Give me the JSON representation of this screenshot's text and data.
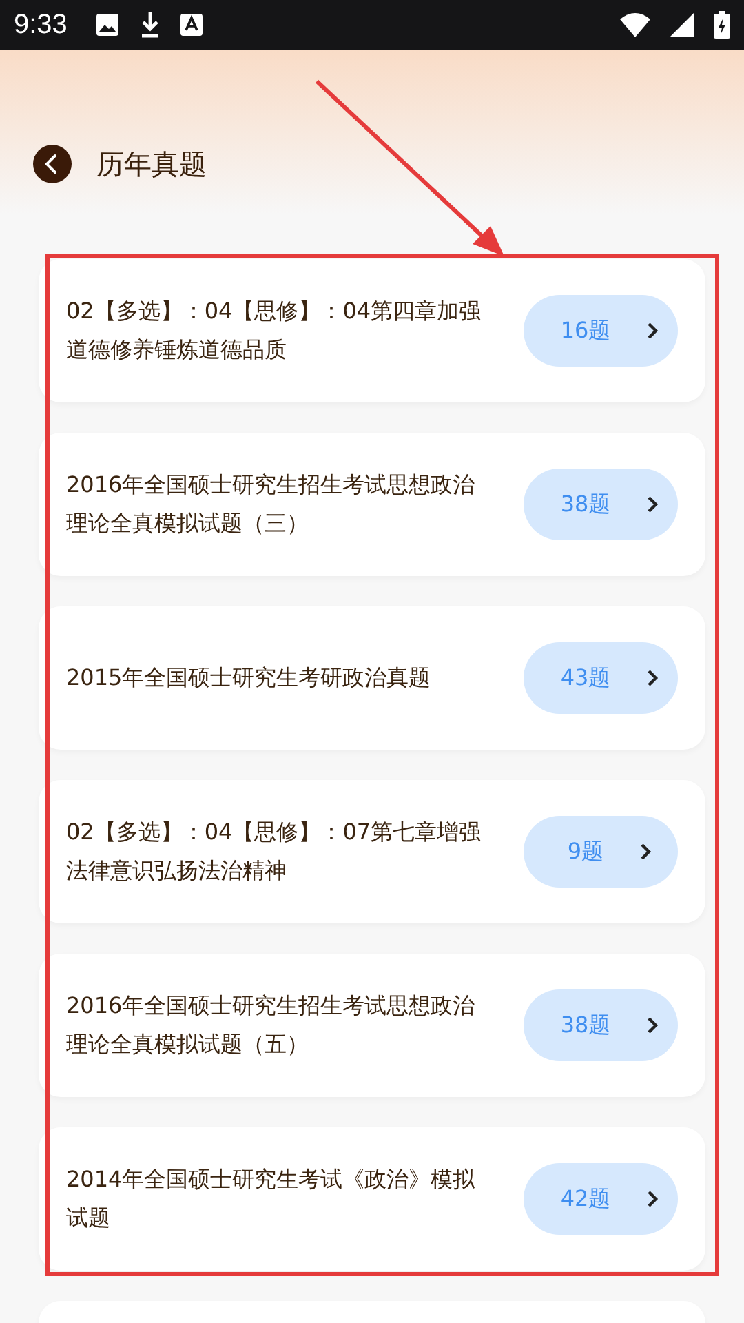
{
  "status_bar": {
    "time": "9:33"
  },
  "header": {
    "title": "历年真题"
  },
  "items": [
    {
      "title": "02【多选】：04【思修】：04第四章加强道德修养锤炼道德品质",
      "count": "16题"
    },
    {
      "title": "2016年全国硕士研究生招生考试思想政治理论全真模拟试题（三）",
      "count": "38题"
    },
    {
      "title": "2015年全国硕士研究生考研政治真题",
      "count": "43题"
    },
    {
      "title": "02【多选】：04【思修】：07第七章增强法律意识弘扬法治精神",
      "count": "9题"
    },
    {
      "title": "2016年全国硕士研究生招生考试思想政治理论全真模拟试题（五）",
      "count": "38题"
    },
    {
      "title": "2014年全国硕士研究生考试《政治》模拟试题",
      "count": "42题"
    }
  ]
}
